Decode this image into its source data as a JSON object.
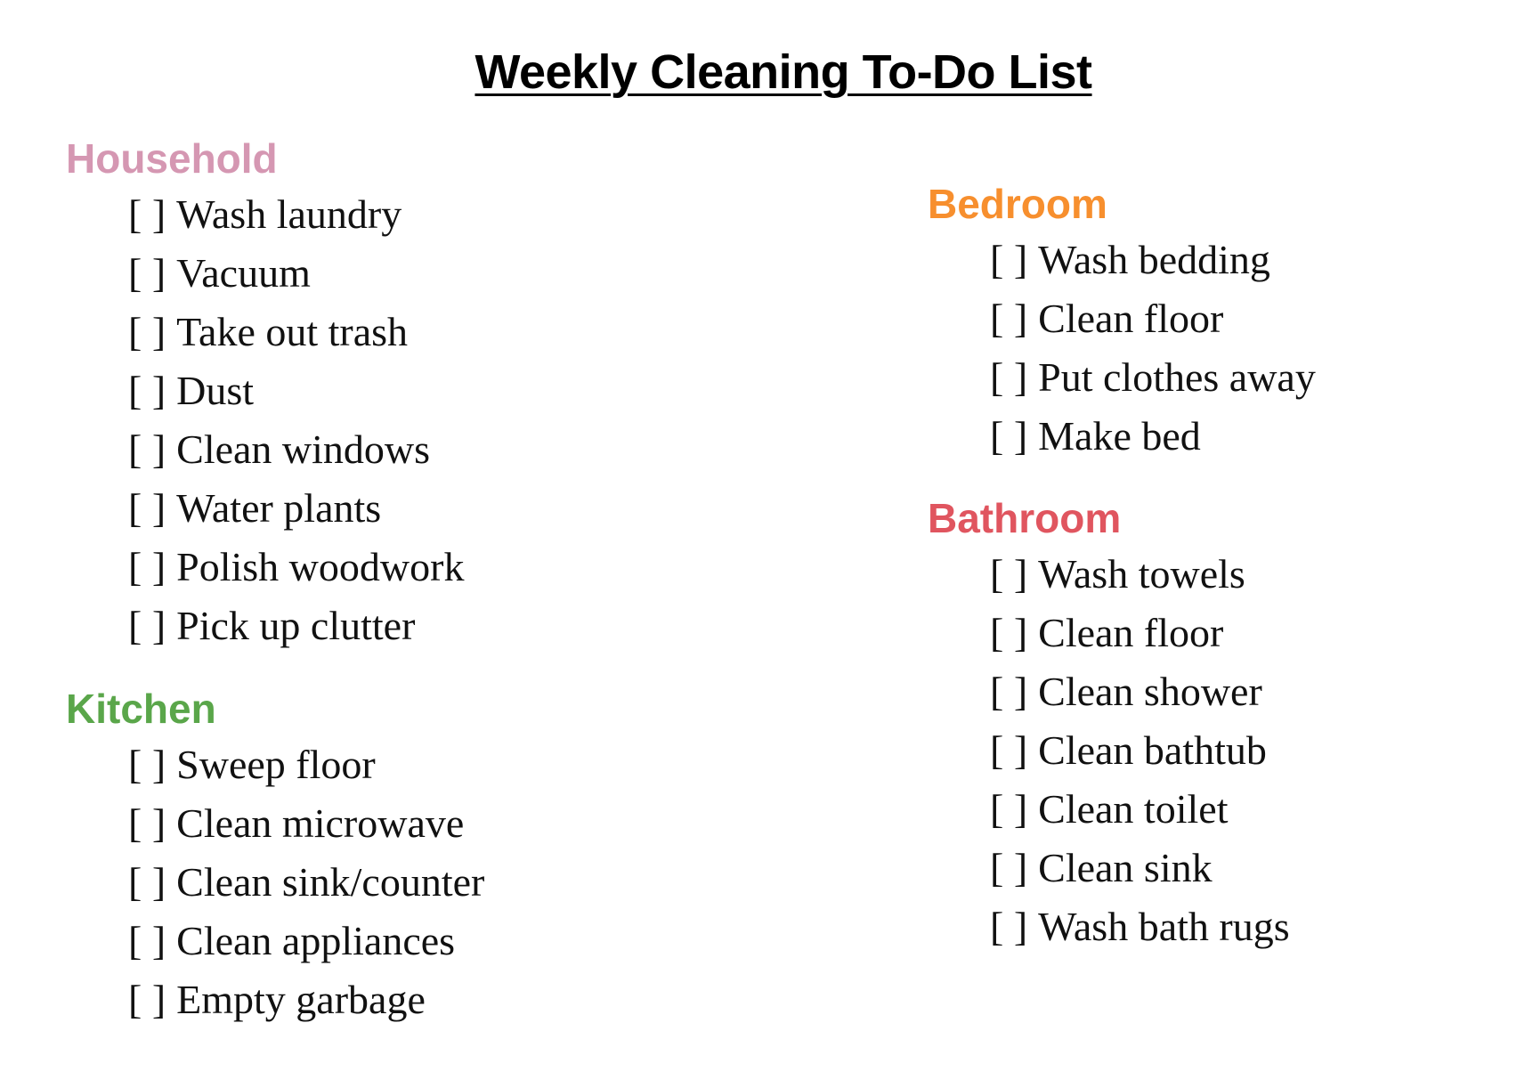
{
  "title": "Weekly Cleaning To-Do List",
  "checkbox_glyph": "[ ]",
  "sections": {
    "household": {
      "heading": "Household",
      "color": "#d597b2",
      "items": [
        "Wash laundry",
        "Vacuum",
        "Take out trash",
        "Dust",
        "Clean windows",
        "Water plants",
        "Polish woodwork",
        "Pick up clutter"
      ]
    },
    "kitchen": {
      "heading": "Kitchen",
      "color": "#5aa64a",
      "items": [
        "Sweep floor",
        "Clean microwave",
        "Clean sink/counter",
        "Clean appliances",
        "Empty garbage"
      ]
    },
    "bedroom": {
      "heading": "Bedroom",
      "color": "#f78f2e",
      "items": [
        "Wash bedding",
        "Clean floor",
        "Put clothes away",
        "Make bed"
      ]
    },
    "bathroom": {
      "heading": "Bathroom",
      "color": "#e0555f",
      "items": [
        "Wash towels",
        "Clean floor",
        "Clean shower",
        "Clean bathtub",
        "Clean toilet",
        "Clean sink",
        "Wash bath rugs"
      ]
    }
  }
}
